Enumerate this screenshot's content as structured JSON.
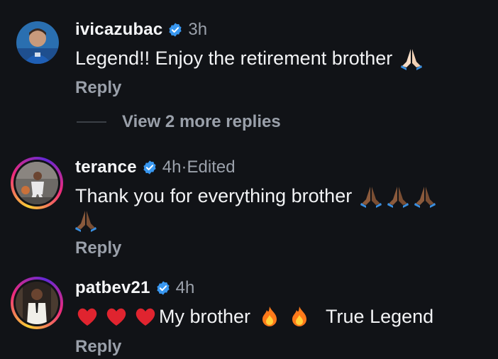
{
  "comments": [
    {
      "username": "ivicazubac",
      "time": "3h",
      "edited": "",
      "text": "Legend!! Enjoy the retirement brother",
      "reply_label": "Reply"
    },
    {
      "username": "terance",
      "time": "4h",
      "edited": "Edited",
      "separator": "·",
      "text": "Thank you for everything brother",
      "reply_label": "Reply"
    },
    {
      "username": "patbev21",
      "time": "4h",
      "edited": "",
      "text_a": "My brother",
      "text_b": "True Legend",
      "reply_label": "Reply"
    }
  ],
  "view_more_replies": "View 2 more replies",
  "colors": {
    "background": "#111317",
    "verified": "#3897f0",
    "muted": "#9aa0aa",
    "heart": "#e0242f",
    "fire": "#ff7a1a"
  },
  "icons": {
    "verified": "verified-badge-icon",
    "pray_light": "pray-light-icon",
    "pray_dark": "pray-dark-icon",
    "heart": "heart-icon",
    "fire": "fire-icon"
  }
}
